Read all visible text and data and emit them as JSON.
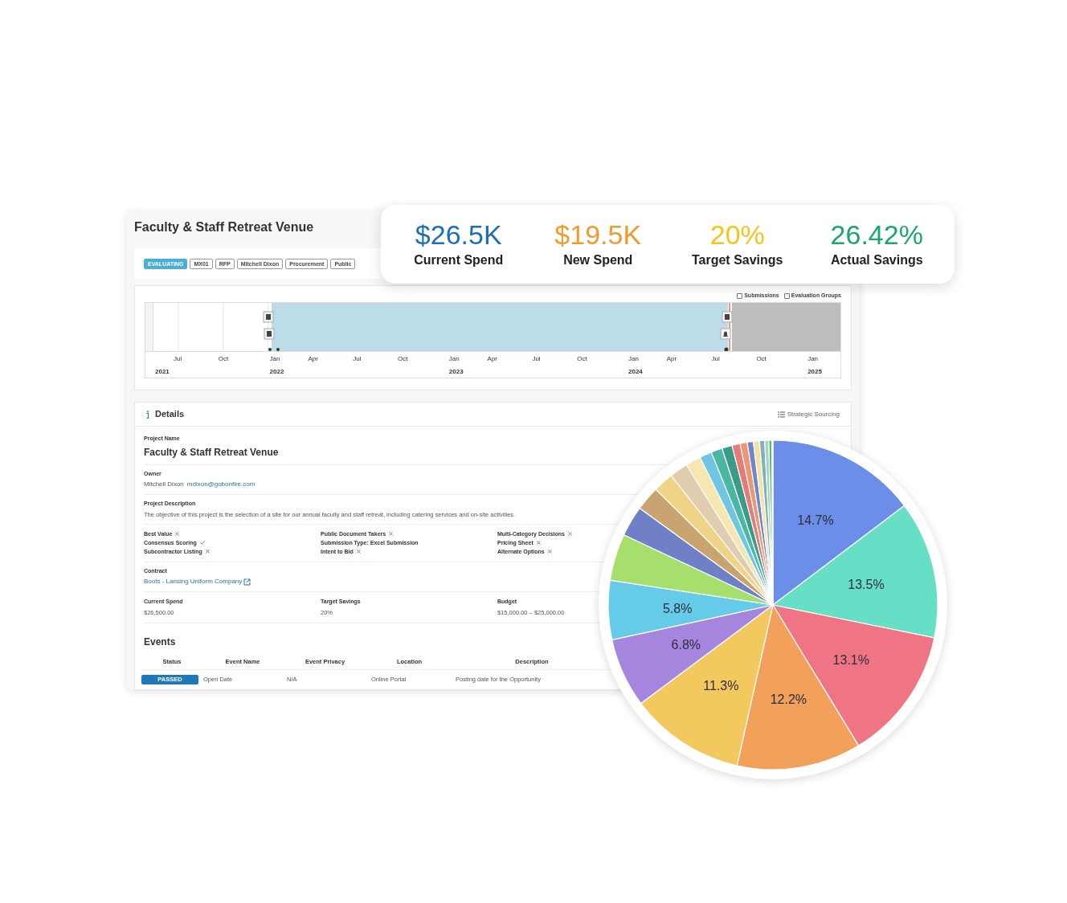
{
  "project": {
    "title": "Faculty & Staff Retreat Venue",
    "tags": [
      {
        "kind": "status",
        "label": "EVALUATING"
      },
      {
        "kind": "tag",
        "label": "MX01"
      },
      {
        "kind": "tag",
        "label": "RFP"
      },
      {
        "kind": "tag",
        "label": "Mitchell Dixon"
      },
      {
        "kind": "tag",
        "label": "Procurement"
      },
      {
        "kind": "tag",
        "label": "Public"
      }
    ]
  },
  "stats": [
    {
      "value": "$26.5K",
      "label": "Current Spend",
      "color": "#1a6fb5"
    },
    {
      "value": "$19.5K",
      "label": "New Spend",
      "color": "#f29a2e"
    },
    {
      "value": "20%",
      "label": "Target Savings",
      "color": "#f5c518"
    },
    {
      "value": "26.42%",
      "label": "Actual Savings",
      "color": "#1ba571"
    }
  ],
  "timeline": {
    "toggles": [
      {
        "label": "Submissions",
        "checked": false
      },
      {
        "label": "Evaluation Groups",
        "checked": false
      }
    ],
    "months": [
      "Jul",
      "Oct",
      "Jan",
      "Apr",
      "Jul",
      "Oct",
      "Jan",
      "Apr",
      "Jul",
      "Oct",
      "Jan",
      "Apr",
      "Jul",
      "Oct",
      "Jan"
    ],
    "years": [
      "2021",
      "2022",
      "2023",
      "2024",
      "2025"
    ]
  },
  "details": {
    "title": "Details",
    "link": "Strategic Sourcing",
    "project_name_label": "Project Name",
    "project_name": "Faculty & Staff Retreat Venue",
    "owner_label": "Owner",
    "owner_name": "Mitchell Dixon",
    "owner_email": "mdixon@gobonfire.com",
    "description_label": "Project Description",
    "description": "The objective of this project is the selection of a site for our annual faculty and staff retreat, including catering services and on-site activities.",
    "flags": [
      [
        {
          "kind": "flag",
          "label": "Best Value",
          "on": false
        },
        {
          "kind": "flag",
          "label": "Consensus Scoring",
          "on": true
        },
        {
          "kind": "flag",
          "label": "Subcontractor Listing",
          "on": false
        }
      ],
      [
        {
          "kind": "flag",
          "label": "Public Document Takers",
          "on": false
        },
        {
          "kind": "text",
          "label": "Submission Type: Excel Submission"
        },
        {
          "kind": "flag",
          "label": "Intent to Bid",
          "on": false
        }
      ],
      [
        {
          "kind": "flag",
          "label": "Multi-Category Decisions",
          "on": false
        },
        {
          "kind": "flag",
          "label": "Pricing Sheet",
          "on": false
        },
        {
          "kind": "flag",
          "label": "Alternate Options",
          "on": false
        }
      ]
    ],
    "contract_label": "Contract",
    "contract": "Boots - Lansing Uniform Company",
    "figures": [
      {
        "label": "Current Spend",
        "value": "$26,500.00"
      },
      {
        "label": "Target Savings",
        "value": "20%"
      },
      {
        "label": "Budget",
        "value": "$15,000.00 – $25,000.00"
      }
    ]
  },
  "events": {
    "title": "Events",
    "columns": [
      "Status",
      "Event Name",
      "Event Privacy",
      "Location",
      "Description"
    ],
    "rows": [
      {
        "cells": [
          "PASSED",
          "Open Date",
          "N/A",
          "Online Portal",
          "Posting date for the Opportunity"
        ]
      }
    ]
  },
  "chart_data": {
    "type": "pie",
    "values": [
      14.7,
      13.5,
      13.1,
      12.2,
      11.3,
      6.8,
      5.8,
      4.6,
      3.0,
      2.4,
      2.0,
      1.8,
      1.5,
      1.2,
      1.1,
      1.0,
      0.8,
      0.7,
      0.6,
      0.6,
      0.5,
      0.4,
      0.3,
      0.1
    ],
    "colors": [
      "#6b8ee8",
      "#66dfc6",
      "#ef7585",
      "#f2a05a",
      "#f3c85f",
      "#a585de",
      "#66cbe8",
      "#a6df6b",
      "#6f80c7",
      "#c9a470",
      "#f0d385",
      "#e0cdb0",
      "#f6e6b0",
      "#6fc6e0",
      "#49b7a4",
      "#3a9c86",
      "#e57b7b",
      "#ec9672",
      "#6f86c9",
      "#f3e2a5",
      "#7fb3b8",
      "#9fd6c6",
      "#5cb86a",
      "#b8e6a6"
    ],
    "value_labels": [
      "14.7%",
      "13.5%",
      "13.1%",
      "12.2%",
      "11.3%",
      "6.8%",
      "5.8%",
      null,
      null,
      null,
      null,
      null,
      null,
      null,
      null,
      null,
      null,
      null,
      null,
      null,
      null,
      null,
      null,
      null
    ]
  }
}
